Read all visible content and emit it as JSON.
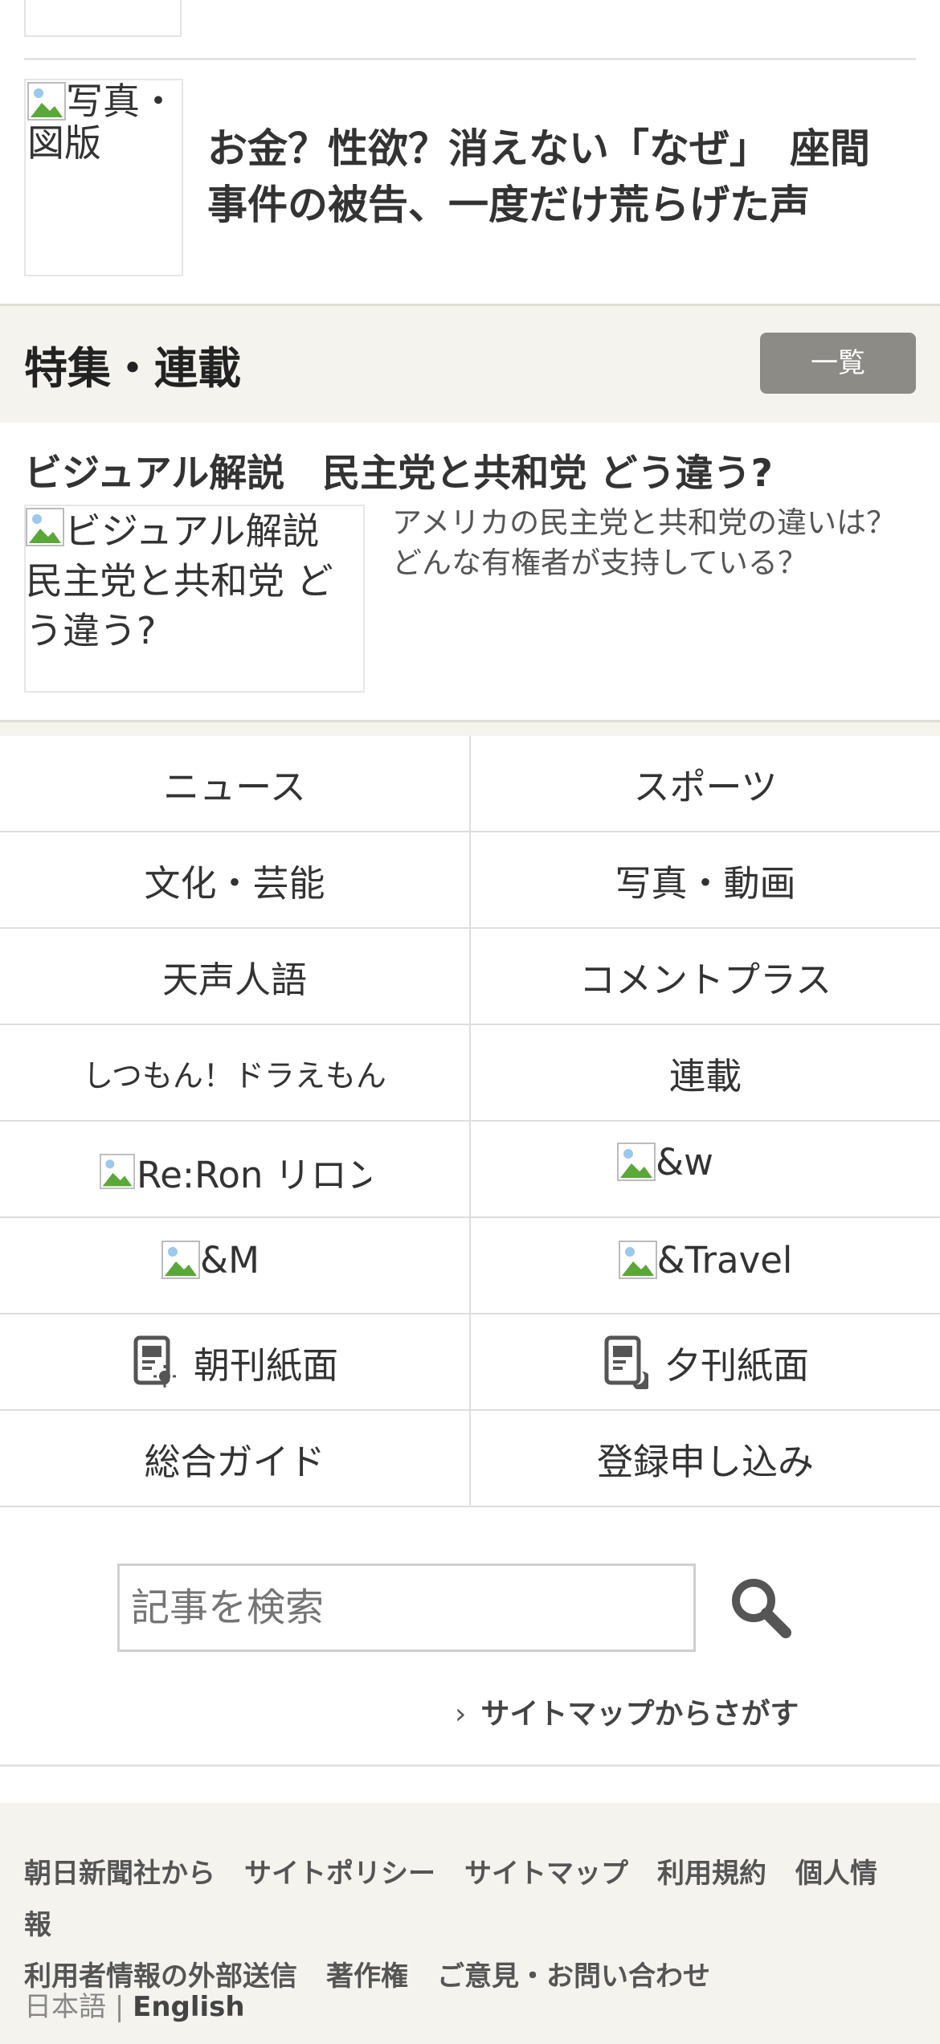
{
  "top_article": {
    "thumb_alt": "写真・図版",
    "headline": "お金？性欲？消えない「なぜ」　座間事件の被告、一度だけ荒らげた声"
  },
  "features": {
    "title": "特集・連載",
    "more_label": "一覧",
    "article": {
      "title": "ビジュアル解説　民主党と共和党 どう違う?",
      "thumb_alt": "ビジュアル解説　民主党と共和党 どう違う?",
      "description": "アメリカの民主党と共和党の違いは？どんな有権者が支持している？"
    }
  },
  "nav_grid": [
    {
      "left": "ニュース",
      "right": "スポーツ"
    },
    {
      "left": "文化・芸能",
      "right": "写真・動画"
    },
    {
      "left": "天声人語",
      "right": "コメントプラス"
    },
    {
      "left": "しつもん！ドラえもん",
      "right": "連載"
    },
    {
      "left": "Re:Ron リロン",
      "right": "&w"
    },
    {
      "left": "&M",
      "right": "&Travel"
    },
    {
      "left": "朝刊紙面",
      "right": "夕刊紙面"
    },
    {
      "left": "総合ガイド",
      "right": "登録申し込み"
    }
  ],
  "search": {
    "placeholder": "記事を検索",
    "button_icon": "search-icon",
    "sitemap_link": "サイトマップからさがす"
  },
  "footer": {
    "links": [
      "朝日新聞社から",
      "サイトポリシー",
      "サイトマップ",
      "利用規約",
      "個人情報",
      "利用者情報の外部送信",
      "著作権",
      "ご意見・お問い合わせ"
    ],
    "lang_ja": "日本語",
    "lang_sep": "|",
    "lang_en": "English"
  },
  "colors": {
    "feature_bg": "#f4f3ee",
    "more_button": "#8c8b86",
    "text": "#333333"
  }
}
